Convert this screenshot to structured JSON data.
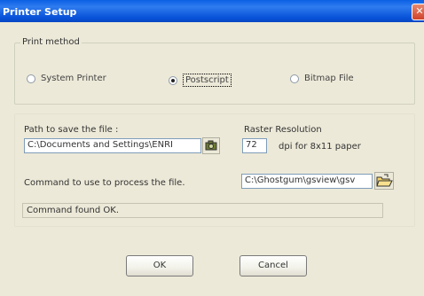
{
  "window": {
    "title": "Printer Setup"
  },
  "print_method": {
    "legend": "Print method",
    "options": [
      {
        "label": "System Printer",
        "checked": false
      },
      {
        "label": "Postscript",
        "checked": true
      },
      {
        "label": "Bitmap File",
        "checked": false
      }
    ]
  },
  "output": {
    "path_label": "Path to save the file :",
    "path_value": "C:\\Documents and Settings\\ENRI",
    "raster_label": "Raster Resolution",
    "raster_value": "72",
    "raster_unit": "dpi for 8x11 paper",
    "command_label": "Command to use to process the file.",
    "command_value": "C:\\Ghostgum\\gsview\\gsv",
    "status_text": "Command found OK."
  },
  "buttons": {
    "ok": "OK",
    "cancel": "Cancel"
  },
  "icons": {
    "path_browse": "camera-folder-icon",
    "command_browse": "open-folder-icon"
  }
}
